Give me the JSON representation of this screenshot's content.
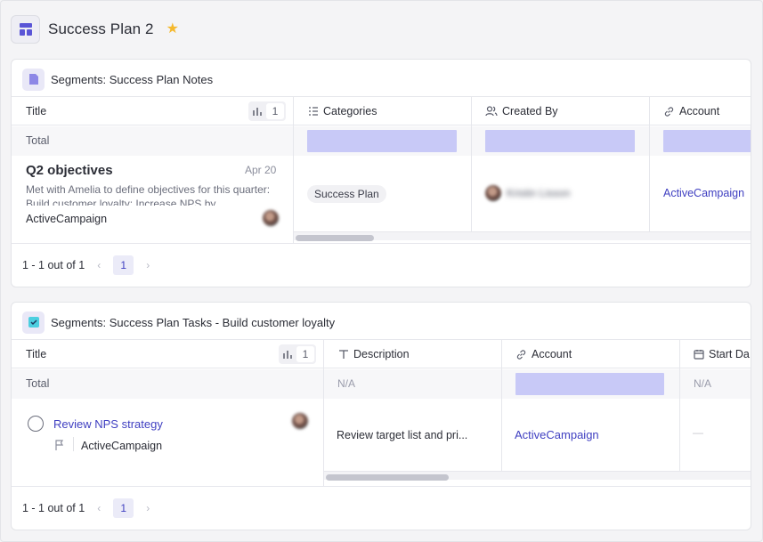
{
  "page": {
    "title": "Success Plan 2",
    "starred": true
  },
  "notes": {
    "title": "Segments: Success Plan Notes",
    "columns": {
      "title": "Title",
      "count": "1",
      "categories": "Categories",
      "created_by": "Created By",
      "account": "Account"
    },
    "total_label": "Total",
    "row": {
      "title": "Q2 objectives",
      "date": "Apr 20",
      "description": "Met with Amelia to define objectives for this quarter: Build customer loyalty; Increase NPS by",
      "account": "ActiveCampaign",
      "category": "Success Plan",
      "created_by": "Kristin Lisson",
      "account_link": "ActiveCampaign"
    },
    "pager": {
      "summary": "1 - 1 out of 1",
      "page": "1"
    }
  },
  "tasks": {
    "title": "Segments: Success Plan Tasks - Build customer loyalty",
    "columns": {
      "title": "Title",
      "count": "1",
      "description": "Description",
      "account": "Account",
      "start_date": "Start Da"
    },
    "total_label": "Total",
    "total_na_1": "N/A",
    "total_na_2": "N/A",
    "row": {
      "title": "Review NPS strategy",
      "account": "ActiveCampaign",
      "description": "Review target list and pri...",
      "account_link": "ActiveCampaign",
      "start_date": "—"
    },
    "pager": {
      "summary": "1 - 1 out of 1",
      "page": "1"
    }
  },
  "colors": {
    "accent": "#3f3fc1",
    "placeholder_bar": "#c8c9f7",
    "star": "#f5b92e",
    "task_icon": "#4ccfe0"
  }
}
